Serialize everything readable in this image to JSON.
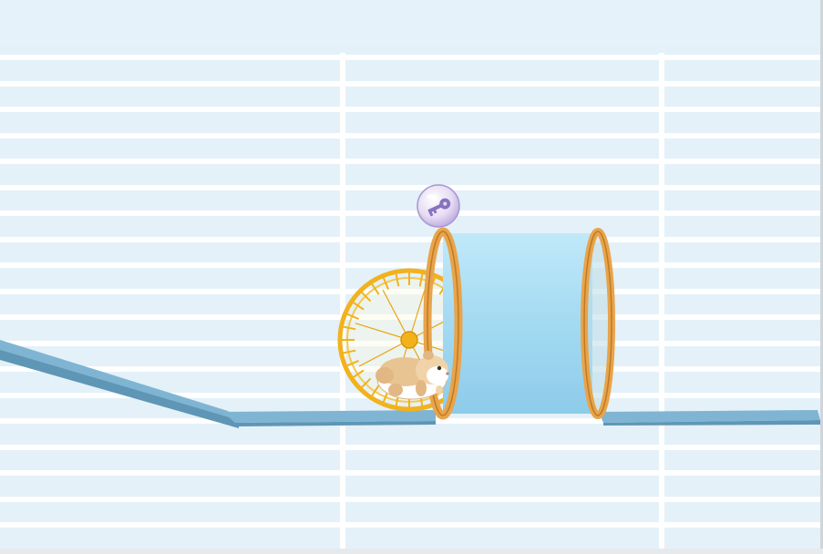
{
  "game": {
    "type": "hamster physics puzzle",
    "collectible": {
      "kind": "key in bubble",
      "icon": "key-icon",
      "collected": false
    },
    "player": {
      "character": "hamster",
      "vehicle": "hamster wheel",
      "icon": "hamster-icon"
    }
  },
  "colors": {
    "background": "#e4f1f9",
    "cage_bars": "#ffffff",
    "platform": "#7db3d0",
    "platform_top": "#95c4dd",
    "platform_edge": "#5f96b5",
    "wheel": "#f2b21c",
    "wheel_dark": "#d9930a",
    "tube_glass": "#8fd0ee",
    "tube_rim": "#e8a44b",
    "tube_rim_dark": "#c07a25",
    "bubble": "#d9cdee",
    "key": "#8a72c2",
    "hamster_fur": "#e8c493",
    "hamster_belly": "#ffffff"
  }
}
